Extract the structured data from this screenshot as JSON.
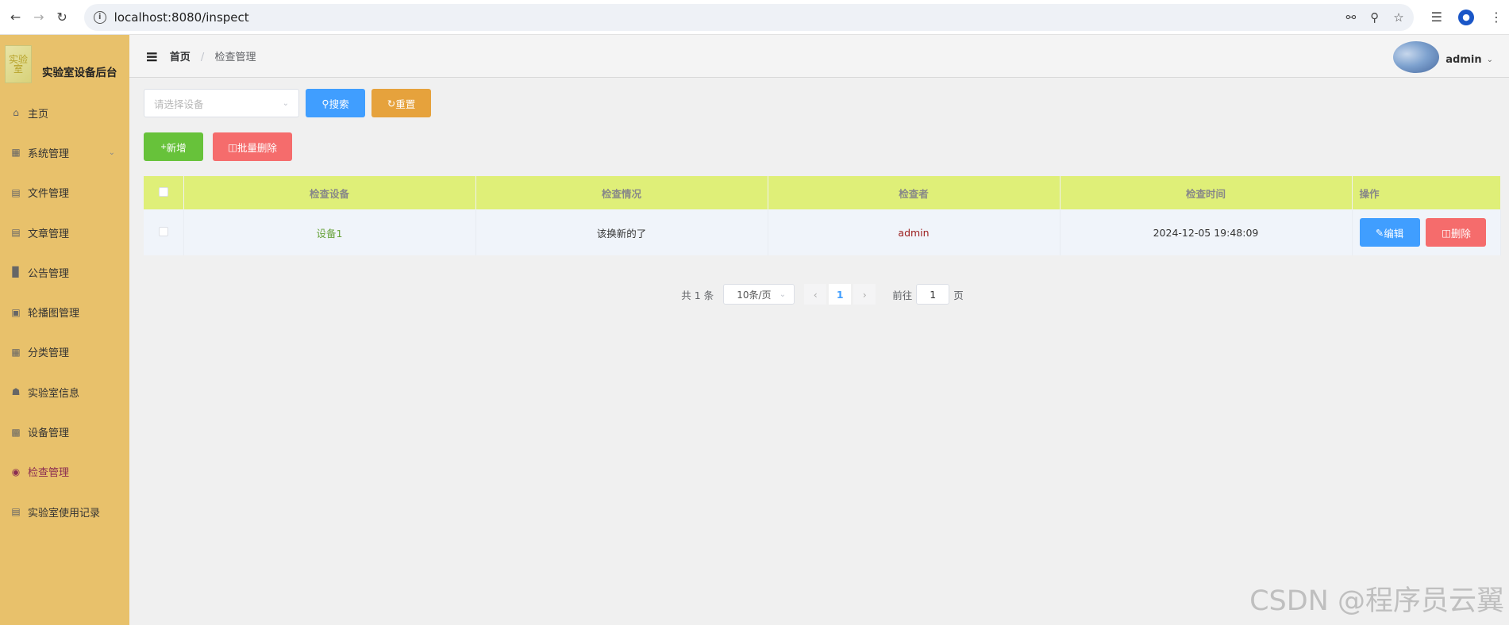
{
  "browser": {
    "url": "localhost:8080/inspect"
  },
  "sidebar": {
    "logo_text": "实验室",
    "title": "实验室设备后台",
    "items": [
      {
        "label": "主页",
        "icon": "home-icon"
      },
      {
        "label": "系统管理",
        "icon": "grid-icon"
      },
      {
        "label": "文件管理",
        "icon": "document-icon"
      },
      {
        "label": "文章管理",
        "icon": "article-icon"
      },
      {
        "label": "公告管理",
        "icon": "bar-chart-icon"
      },
      {
        "label": "轮播图管理",
        "icon": "carousel-icon"
      },
      {
        "label": "分类管理",
        "icon": "category-icon"
      },
      {
        "label": "实验室信息",
        "icon": "house-icon"
      },
      {
        "label": "设备管理",
        "icon": "device-icon"
      },
      {
        "label": "检查管理",
        "icon": "eye-icon"
      },
      {
        "label": "实验室使用记录",
        "icon": "record-icon"
      }
    ]
  },
  "header": {
    "breadcrumb_home": "首页",
    "breadcrumb_separator": "/",
    "breadcrumb_current": "检查管理",
    "username": "admin"
  },
  "search": {
    "placeholder": "请选择设备",
    "search_label": "搜索",
    "reset_label": "重置"
  },
  "actions": {
    "add_label": "新增",
    "batch_delete_label": "批量删除"
  },
  "table": {
    "columns": [
      "检查设备",
      "检查情况",
      "检查者",
      "检查时间",
      "操作"
    ],
    "rows": [
      {
        "device": "设备1",
        "status": "该换新的了",
        "inspector": "admin",
        "time": "2024-12-05 19:48:09",
        "edit": "编辑",
        "delete": "删除"
      }
    ]
  },
  "pagination": {
    "total_text": "共 1 条",
    "page_size": "10条/页",
    "current_page": "1",
    "goto_label": "前往",
    "goto_value": "1",
    "page_suffix": "页"
  },
  "watermark": "CSDN @程序员云翼",
  "colors": {
    "sidebar_bg": "#e8c16b",
    "header_row_bg": "#dfef78",
    "primary": "#409eff",
    "warning": "#e6a23c",
    "success": "#67c23a",
    "danger": "#f56c6c",
    "active_menu": "#8b2d52"
  }
}
